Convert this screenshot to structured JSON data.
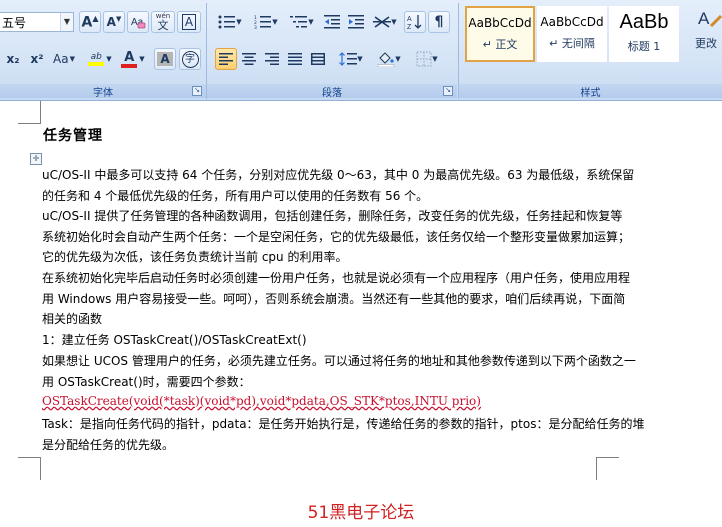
{
  "ribbon": {
    "font_group": {
      "label": "字体",
      "font_size": "五号",
      "grow_font": "A",
      "shrink_font": "A",
      "phonetic": "wén",
      "char_border": "A",
      "subscript": "x₂",
      "superscript": "x²",
      "change_case": "Aa",
      "highlight": "ab",
      "font_color": "A",
      "char_shading": "A",
      "enclose": "字"
    },
    "paragraph_group": {
      "label": "段落"
    },
    "styles_group": {
      "label": "样式",
      "styles": [
        {
          "sample": "AaBbCcDd",
          "name": "↵ 正文"
        },
        {
          "sample": "AaBbCcDd",
          "name": "↵ 无间隔"
        },
        {
          "sample": "AaBb",
          "name": "标题 1"
        }
      ],
      "change_styles": "更改"
    },
    "colors": {
      "highlight": "#ffff00",
      "font_color": "#e02020",
      "active": "#ffcf6e"
    }
  },
  "document": {
    "title": "任务管理",
    "lines": [
      "uC/OS-II 中最多可以支持 64 个任务，分别对应优先级 0～63，其中 0 为最高优先级。63 为最低级，系统保留",
      "的任务和 4 个最低优先级的任务，所有用户可以使用的任务数有 56 个。",
      "uC/OS-II 提供了任务管理的各种函数调用，包括创建任务，删除任务，改变任务的优先级，任务挂起和恢复等",
      "系统初始化时会自动产生两个任务：一个是空闲任务，它的优先级最低，该任务仅给一个整形变量做累加运算；",
      "它的优先级为次低，该任务负责统计当前 cpu 的利用率。",
      "在系统初始化完毕后启动任务时必须创建一份用户任务，也就是说必须有一个应用程序（用户任务，使用应用程",
      "用 Windows 用户容易接受一些。呵呵），否则系统会崩溃。当然还有一些其他的要求，咱们后续再说，下面简",
      "相关的函数",
      "1：建立任务 OSTaskCreat()/OSTaskCreatExt()",
      "如果想让 UCOS 管理用户的任务，必须先建立任务。可以通过将任务的地址和其他参数传递到以下两个函数之一",
      "用 OSTaskCreat()时，需要四个参数：",
      "OSTaskCreate(void(*task)(void*pd),void*pdata,OS_STK*ptos,INTU prio)",
      "Task：是指向任务代码的指针，pdata：是任务开始执行是，传递给任务的参数的指针，ptos：是分配给任务的堆",
      "是分配给任务的优先级。"
    ],
    "code_color": "#c8102e"
  },
  "watermark": "51黑电子论坛"
}
